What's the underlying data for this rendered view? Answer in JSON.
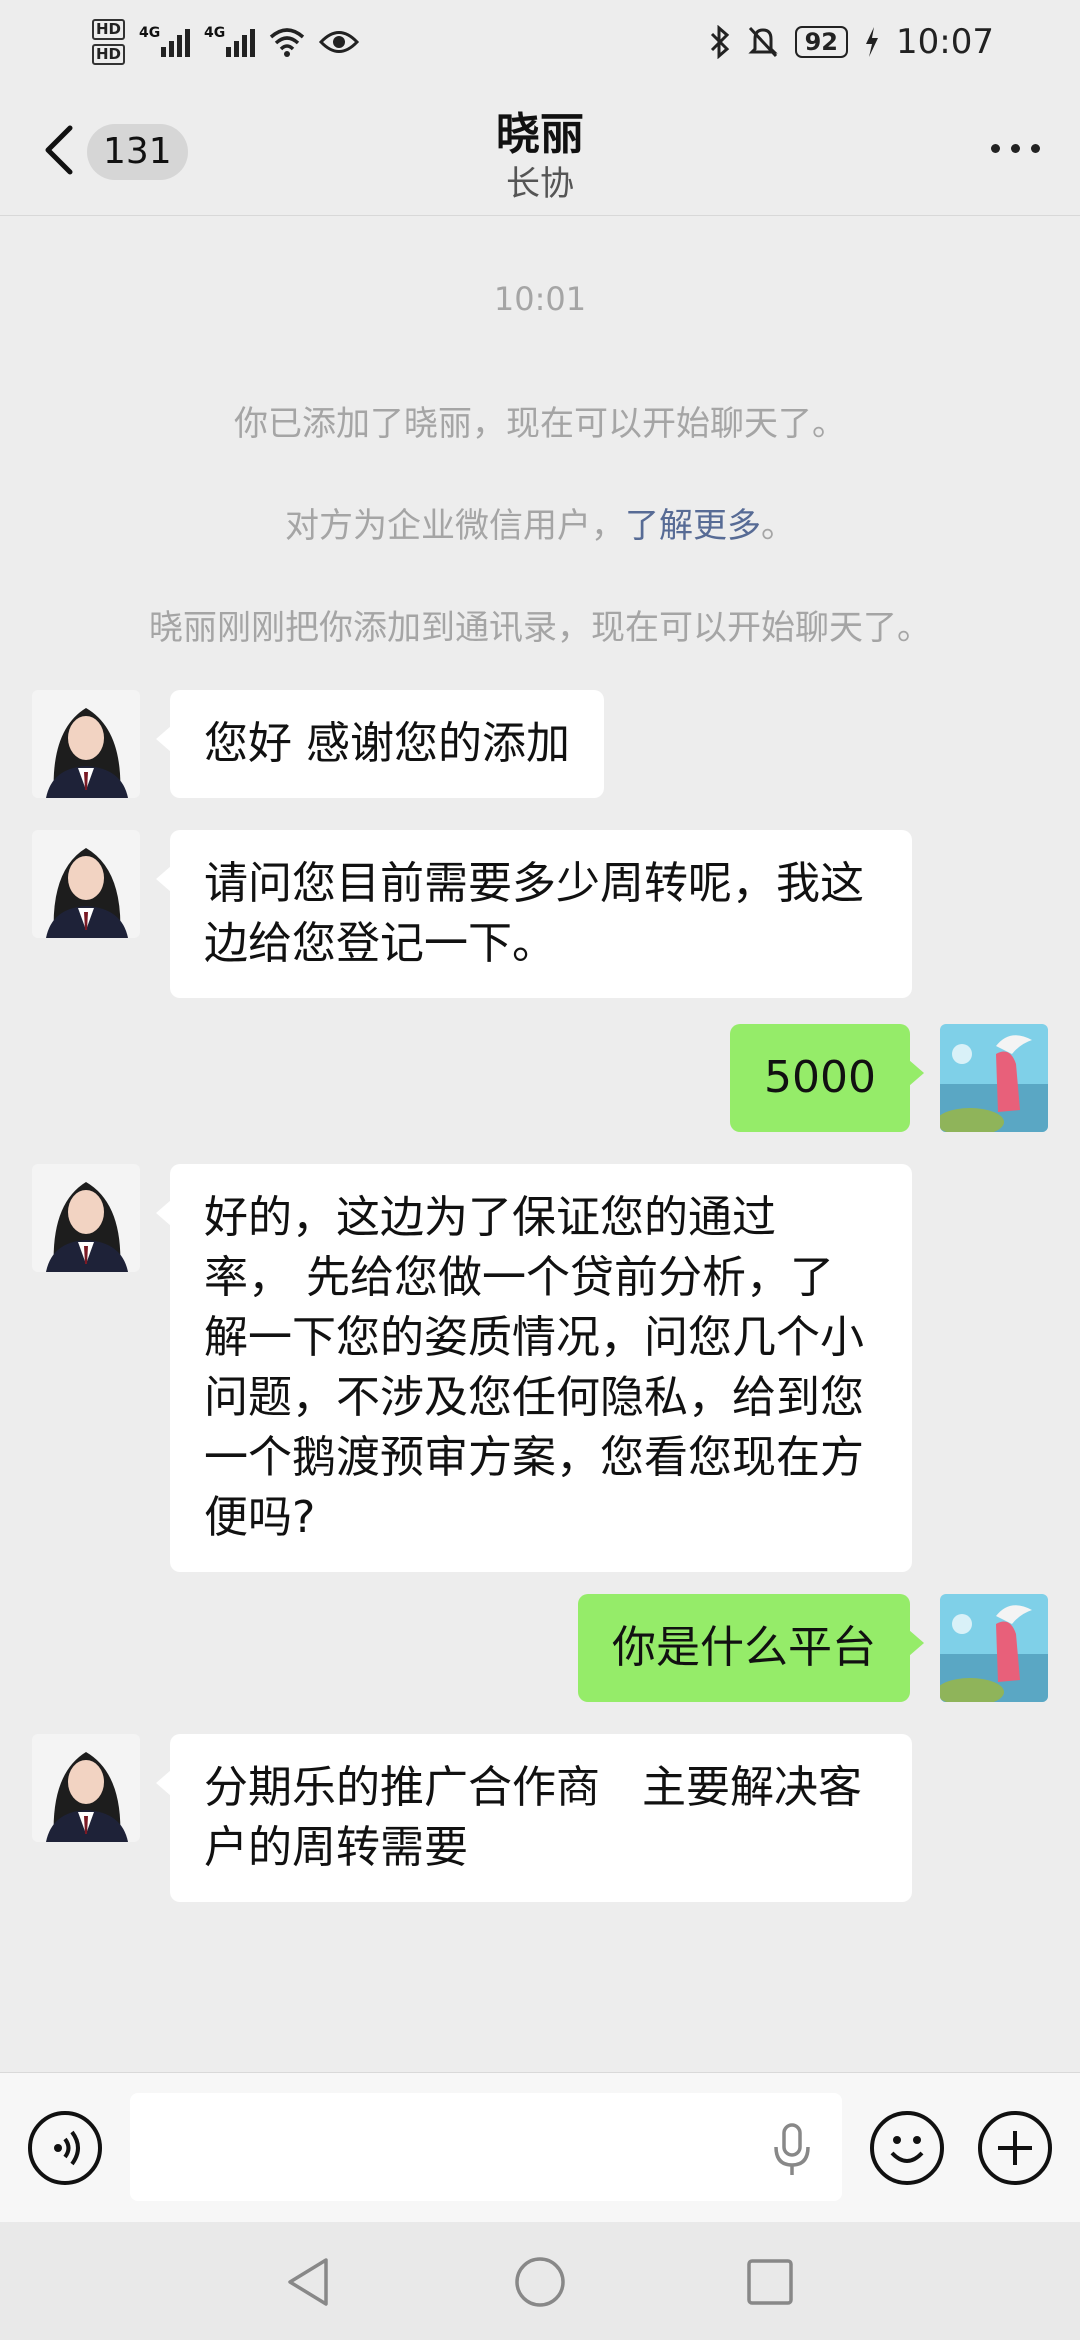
{
  "status_bar": {
    "hd1": "HD",
    "hd2": "HD",
    "net1": "4G",
    "net2": "4G",
    "battery": "92",
    "time": "10:07"
  },
  "nav": {
    "unread_count": "131",
    "title": "晓丽",
    "subtitle": "长协"
  },
  "system_messages": {
    "timestamp": "10:01",
    "added": "你已添加了晓丽，现在可以开始聊天了。",
    "enterprise_prefix": "对方为企业微信用户，",
    "enterprise_link": "了解更多",
    "enterprise_suffix": "。",
    "contact_added": "晓丽刚刚把你添加到通讯录，现在可以开始聊天了。"
  },
  "messages": [
    {
      "from": "them",
      "lines": [
        "您好 感谢您的添加"
      ]
    },
    {
      "from": "them",
      "lines": [
        "请问您目前需要多少周转呢，我这",
        "边给您登记一下。"
      ]
    },
    {
      "from": "me",
      "lines": [
        "5000"
      ]
    },
    {
      "from": "them",
      "lines": [
        "好的，这边为了保证您的通过",
        "率， 先给您做一个贷前分析，了",
        "解一下您的姿质情况，问您几个小",
        "问题，不涉及您任何隐私，给到您",
        "一个鹅渡预审方案，您看您现在方",
        "便吗?"
      ]
    },
    {
      "from": "me",
      "lines": [
        "你是什么平台"
      ]
    },
    {
      "from": "them",
      "lines": [
        "分期乐的推广合作商   主要解决客",
        "户的周转需要"
      ]
    }
  ],
  "colors": {
    "background": "#ededed",
    "incoming_bubble": "#ffffff",
    "outgoing_bubble": "#95ec69",
    "link": "#576b95",
    "system_text": "#a5a5a5"
  },
  "icons": [
    "hd-icon",
    "signal-icon",
    "wifi-icon",
    "eye-icon",
    "bluetooth-icon",
    "mute-bell-icon",
    "battery-icon",
    "charging-icon",
    "back-arrow-icon",
    "more-icon",
    "voice-icon",
    "microphone-icon",
    "emoji-icon",
    "plus-icon",
    "nav-back-icon",
    "nav-home-icon",
    "nav-recents-icon"
  ]
}
